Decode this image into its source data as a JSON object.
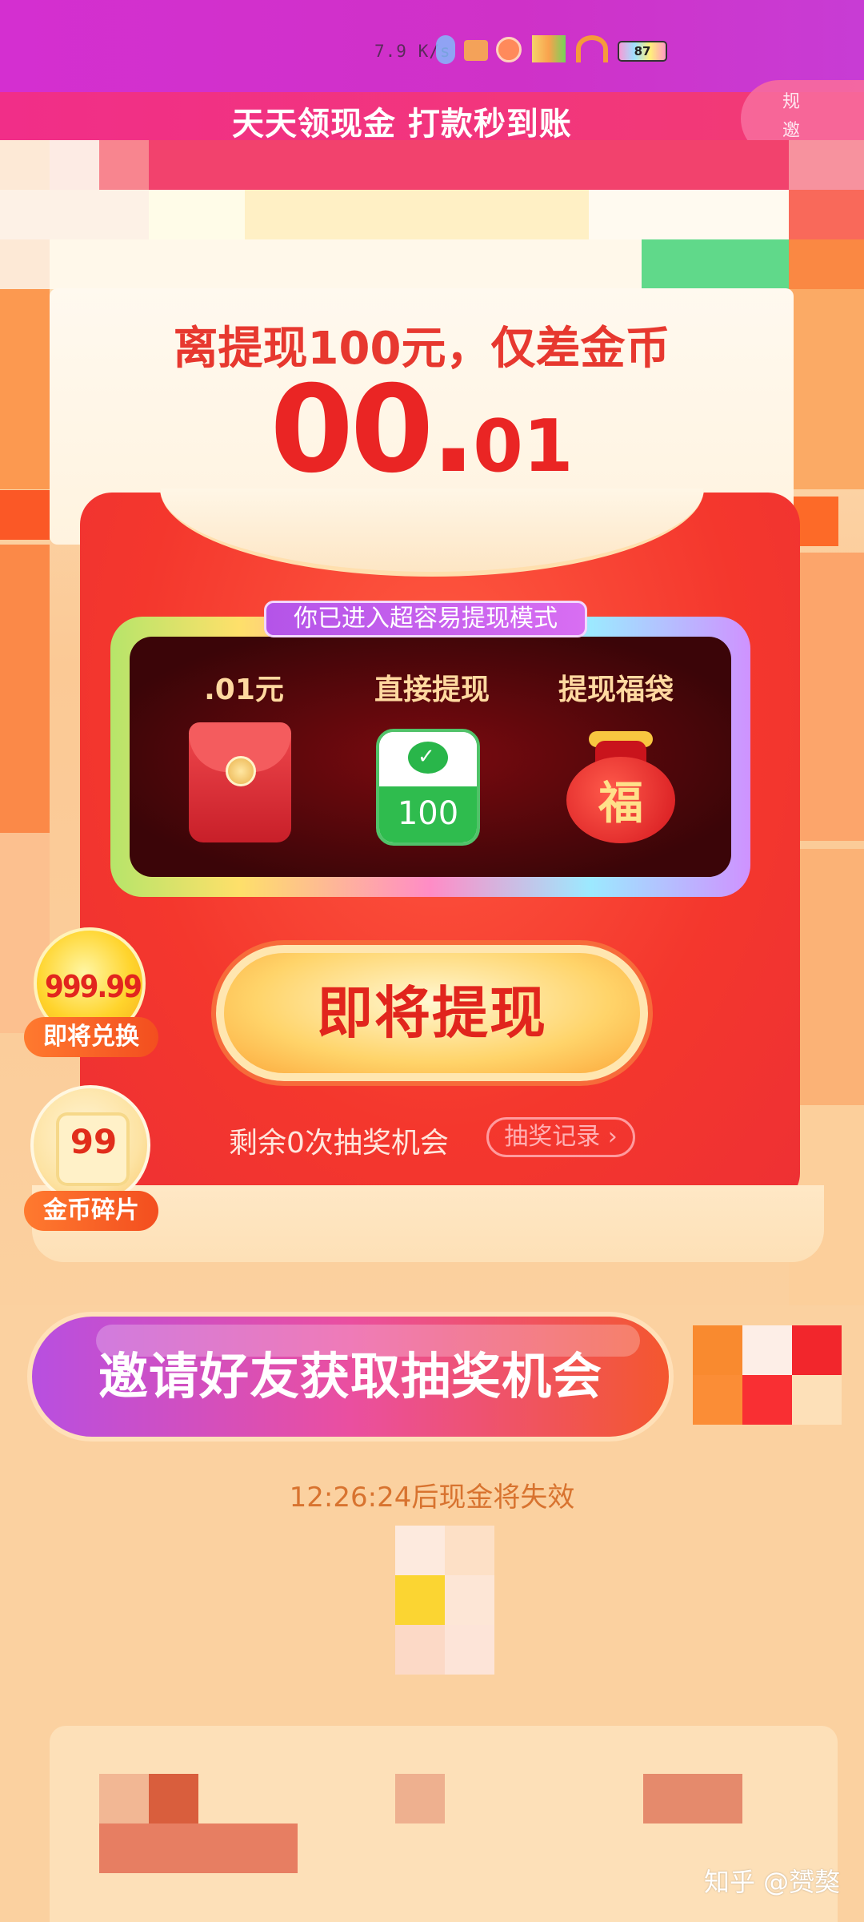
{
  "status_bar": {
    "speed": "7.9 K/s",
    "battery": "87"
  },
  "header": {
    "title": "天天领现金 打款秒到账",
    "side_button": "规 邀"
  },
  "progress": {
    "line": "离提现100元，仅差金币",
    "amount_main": "00.",
    "amount_dec": "01"
  },
  "mode_badge": "你已进入超容易提现模式",
  "rewards": [
    {
      "label": ".01元",
      "icon": "red-envelope"
    },
    {
      "label": "直接提现",
      "icon": "wechat-pay",
      "value": "100"
    },
    {
      "label": "提现福袋",
      "icon": "lucky-bag",
      "char": "福"
    }
  ],
  "cta": {
    "label": "即将提现"
  },
  "lottery": {
    "remaining": "剩余0次抽奖机会",
    "record": "抽奖记录 ›"
  },
  "floating": [
    {
      "value": "999.99",
      "label": "即将兑换"
    },
    {
      "value": "99",
      "label": "金币碎片"
    }
  ],
  "invite": {
    "label": "邀请好友获取抽奖机会"
  },
  "countdown": "12:26:24后现金将失效",
  "watermark": "知乎 @赟獒",
  "colors": {
    "brand_red": "#ea2524",
    "status_magenta": "#d42fd0",
    "title_pink": "#f12e88"
  }
}
